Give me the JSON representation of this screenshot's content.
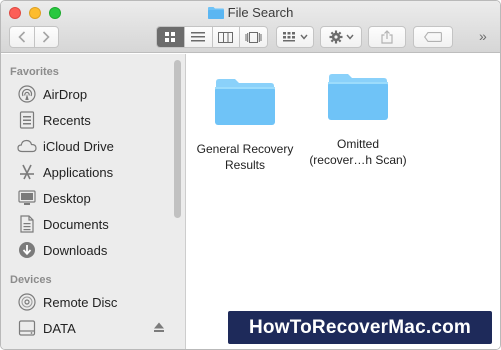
{
  "window": {
    "title": "File Search"
  },
  "sidebar": {
    "sections": [
      {
        "header": "Favorites",
        "items": [
          {
            "label": "AirDrop",
            "icon": "airdrop-icon"
          },
          {
            "label": "Recents",
            "icon": "recents-icon"
          },
          {
            "label": "iCloud Drive",
            "icon": "icloud-icon"
          },
          {
            "label": "Applications",
            "icon": "applications-icon"
          },
          {
            "label": "Desktop",
            "icon": "desktop-icon"
          },
          {
            "label": "Documents",
            "icon": "documents-icon"
          },
          {
            "label": "Downloads",
            "icon": "downloads-icon"
          }
        ]
      },
      {
        "header": "Devices",
        "items": [
          {
            "label": "Remote Disc",
            "icon": "disc-icon"
          },
          {
            "label": "DATA",
            "icon": "drive-icon"
          }
        ]
      }
    ]
  },
  "content": {
    "items": [
      {
        "label_line1": "General Recovery",
        "label_line2": "Results"
      },
      {
        "label_line1": "Omitted",
        "label_line2": "(recover…h Scan)"
      }
    ]
  },
  "watermark": "HowToRecoverMac.com",
  "colors": {
    "folder": "#6fc3f7",
    "folder_tab": "#8ad1fa",
    "watermark_bg": "#1e2a5a"
  }
}
